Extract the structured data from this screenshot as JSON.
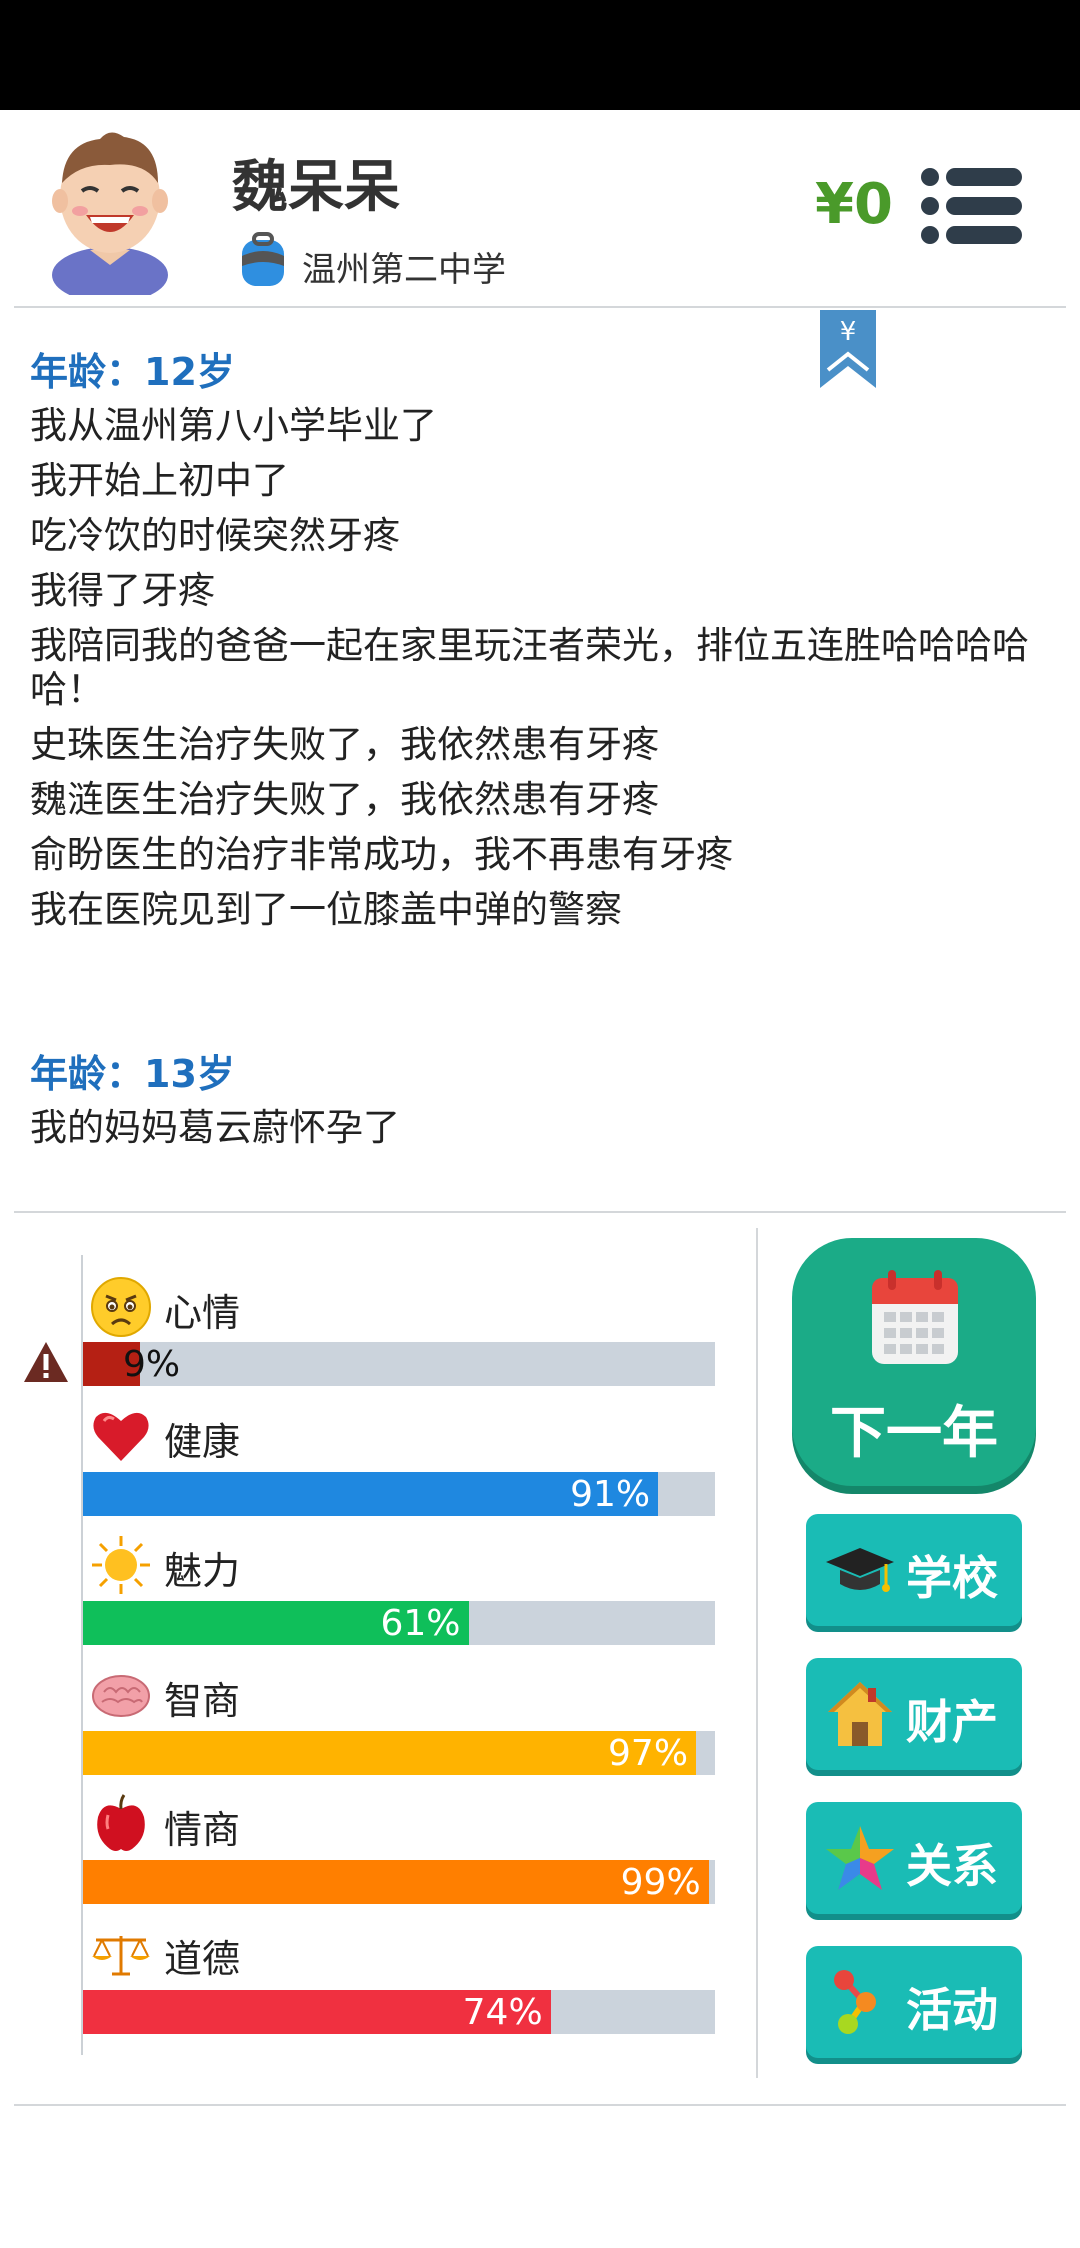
{
  "header": {
    "name": "魏呆呆",
    "school": "温州第二中学",
    "money": "¥0",
    "bookmark_symbol": "¥"
  },
  "log": [
    {
      "age_label": "年龄：12岁",
      "events": [
        "我从温州第八小学毕业了",
        "我开始上初中了",
        "吃冷饮的时候突然牙疼",
        "我得了牙疼",
        "我陪同我的爸爸一起在家里玩汪者荣光，排位五连胜哈哈哈哈哈！",
        "史珠医生治疗失败了，我依然患有牙疼",
        "魏涟医生治疗失败了，我依然患有牙疼",
        "俞盼医生的治疗非常成功，我不再患有牙疼",
        "我在医院见到了一位膝盖中弹的警察"
      ]
    },
    {
      "age_label": "年龄：13岁",
      "events": [
        "我的妈妈葛云蔚怀孕了"
      ]
    }
  ],
  "stats": [
    {
      "name": "心情",
      "value": 9,
      "text": "9%",
      "color": "#b52014",
      "icon": "worried-face-icon"
    },
    {
      "name": "健康",
      "value": 91,
      "text": "91%",
      "color": "#1f88e0",
      "icon": "heart-icon"
    },
    {
      "name": "魅力",
      "value": 61,
      "text": "61%",
      "color": "#0fbf5a",
      "icon": "sun-icon"
    },
    {
      "name": "智商",
      "value": 97,
      "text": "97%",
      "color": "#ffb300",
      "icon": "brain-icon"
    },
    {
      "name": "情商",
      "value": 99,
      "text": "99%",
      "color": "#ff7f00",
      "icon": "apple-icon"
    },
    {
      "name": "道德",
      "value": 74,
      "text": "74%",
      "color": "#f03040",
      "icon": "scales-icon"
    }
  ],
  "actions": {
    "next_year": "下一年",
    "school": "学校",
    "property": "财产",
    "relations": "关系",
    "activities": "活动"
  },
  "colors": {
    "money": "#4a9a2a",
    "age_label": "#1f6fbd",
    "next_button": "#1bab87",
    "side_button": "#1abcb5"
  }
}
